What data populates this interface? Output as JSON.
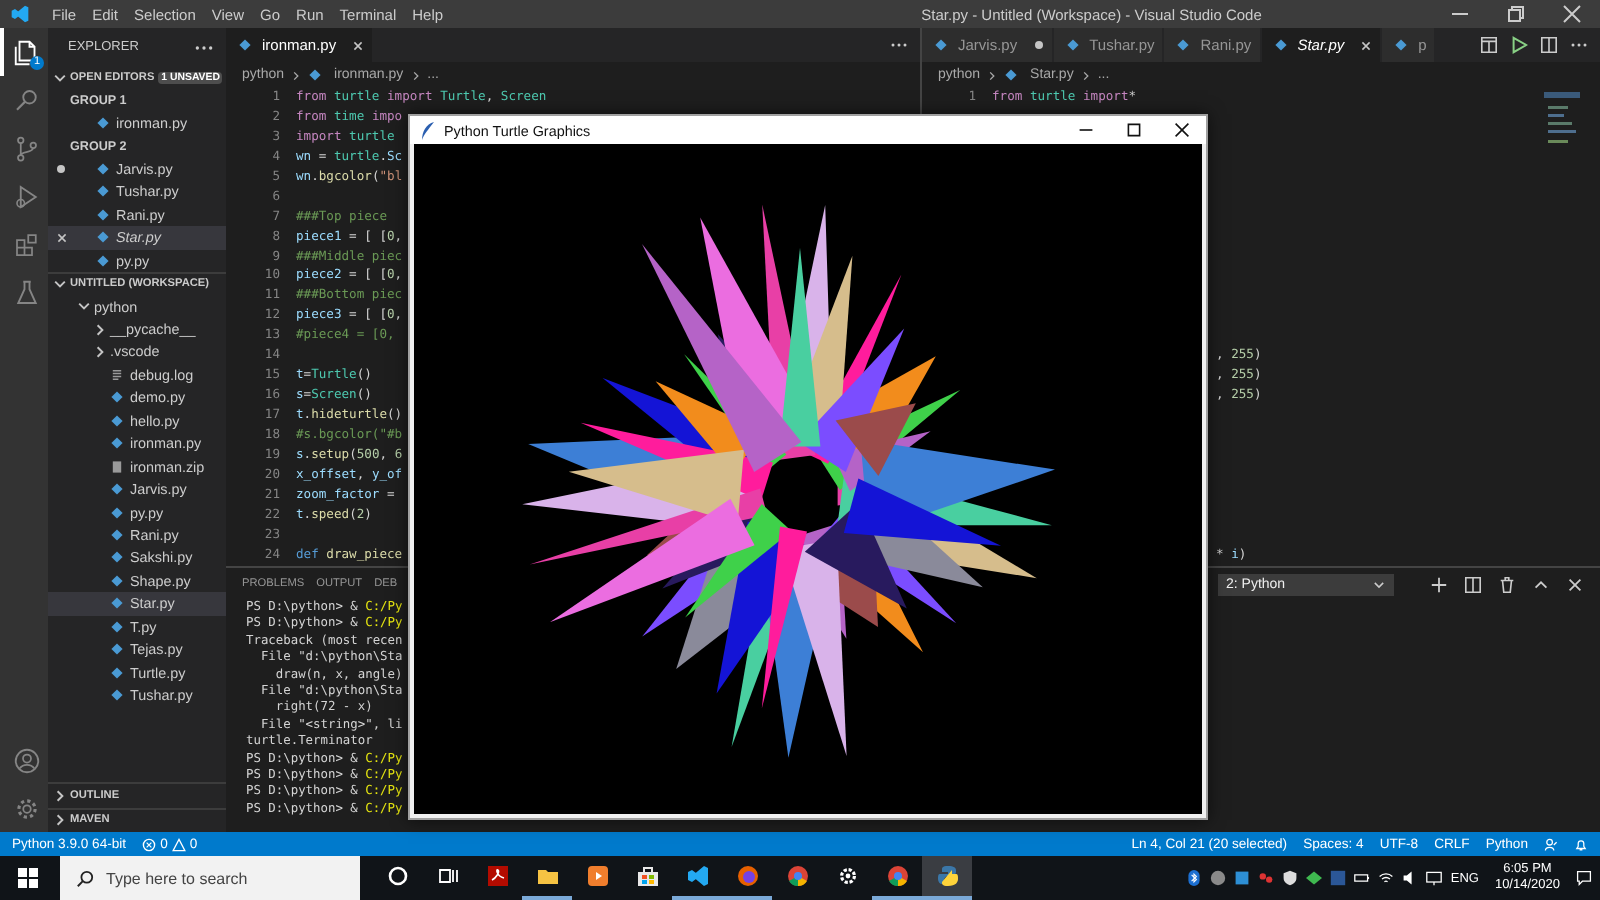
{
  "title_bar": {
    "menu": [
      "File",
      "Edit",
      "Selection",
      "View",
      "Go",
      "Run",
      "Terminal",
      "Help"
    ],
    "title": "Star.py - Untitled (Workspace) - Visual Studio Code"
  },
  "activity_bar": {
    "items": [
      {
        "kind": "explorer",
        "selected": true,
        "badge": "1"
      },
      {
        "kind": "search",
        "selected": false
      },
      {
        "kind": "source-control",
        "selected": false
      },
      {
        "kind": "run",
        "selected": false
      },
      {
        "kind": "extensions",
        "selected": false
      },
      {
        "kind": "testing",
        "selected": false
      }
    ]
  },
  "sidebar": {
    "title": "EXPLORER",
    "open_editors": {
      "title": "OPEN EDITORS",
      "badge": "1 UNSAVED",
      "expanded": true,
      "groups": [
        {
          "title": "GROUP 1",
          "files": [
            {
              "name": "ironman.py",
              "selected": false,
              "dirty": false,
              "preview": false
            }
          ]
        },
        {
          "title": "GROUP 2",
          "files": [
            {
              "name": "Jarvis.py",
              "selected": false,
              "dirty": true,
              "preview": false
            },
            {
              "name": "Tushar.py",
              "selected": false,
              "dirty": false,
              "preview": false
            },
            {
              "name": "Rani.py",
              "selected": false,
              "dirty": false,
              "preview": false
            },
            {
              "name": "Star.py",
              "selected": true,
              "dirty": false,
              "preview": true
            },
            {
              "name": "py.py",
              "selected": false,
              "dirty": false,
              "preview": false
            }
          ]
        }
      ]
    },
    "workspace": {
      "title": "UNTITLED (WORKSPACE)",
      "expanded": true,
      "children": [
        {
          "name": "python",
          "kind": "folder",
          "expanded": true,
          "children": [
            {
              "name": "__pycache__",
              "kind": "folder",
              "expanded": false
            },
            {
              "name": ".vscode",
              "kind": "folder",
              "expanded": false
            },
            {
              "name": "debug.log",
              "kind": "log",
              "selected": false
            },
            {
              "name": "demo.py",
              "kind": "python",
              "selected": false
            },
            {
              "name": "hello.py",
              "kind": "python",
              "selected": false
            },
            {
              "name": "ironman.py",
              "kind": "python",
              "selected": false
            },
            {
              "name": "ironman.zip",
              "kind": "zip",
              "selected": false
            },
            {
              "name": "Jarvis.py",
              "kind": "python",
              "selected": false
            },
            {
              "name": "py.py",
              "kind": "python",
              "selected": false
            },
            {
              "name": "Rani.py",
              "kind": "python",
              "selected": false
            },
            {
              "name": "Sakshi.py",
              "kind": "python",
              "selected": false
            },
            {
              "name": "Shape.py",
              "kind": "python",
              "selected": false
            },
            {
              "name": "Star.py",
              "kind": "python",
              "selected": true
            },
            {
              "name": "T.py",
              "kind": "python",
              "selected": false
            },
            {
              "name": "Tejas.py",
              "kind": "python",
              "selected": false
            },
            {
              "name": "Turtle.py",
              "kind": "python",
              "selected": false
            },
            {
              "name": "Tushar.py",
              "kind": "python",
              "selected": false
            }
          ]
        }
      ]
    },
    "sections": [
      {
        "title": "OUTLINE",
        "expanded": false
      },
      {
        "title": "MAVEN",
        "expanded": false
      }
    ]
  },
  "left_editor": {
    "tabs": [
      {
        "label": "ironman.py",
        "selected": true,
        "dirty": false,
        "preview": false
      }
    ],
    "breadcrumbs": [
      {
        "text": "python",
        "kind": "folder"
      },
      {
        "text": "ironman.py",
        "kind": "file"
      },
      {
        "text": "...",
        "kind": "symbol"
      }
    ],
    "lines": [
      {
        "number": "1",
        "tokens": [
          {
            "text": "from ",
            "kind": "kw"
          },
          {
            "text": "turtle ",
            "kind": "type"
          },
          {
            "text": "import ",
            "kind": "kw"
          },
          {
            "text": "Turtle",
            "kind": "type"
          },
          {
            "text": ", ",
            "kind": "plain"
          },
          {
            "text": "Screen",
            "kind": "type"
          }
        ]
      },
      {
        "number": "2",
        "tokens": [
          {
            "text": "from ",
            "kind": "kw"
          },
          {
            "text": "time ",
            "kind": "type"
          },
          {
            "text": "impo",
            "kind": "kw"
          }
        ]
      },
      {
        "number": "3",
        "tokens": [
          {
            "text": "import ",
            "kind": "kw"
          },
          {
            "text": "turtle",
            "kind": "type"
          }
        ]
      },
      {
        "number": "4",
        "tokens": [
          {
            "text": "wn",
            "kind": "var"
          },
          {
            "text": " = ",
            "kind": "plain"
          },
          {
            "text": "turtle",
            "kind": "type"
          },
          {
            "text": ".",
            "kind": "plain"
          },
          {
            "text": "Sc",
            "kind": "var"
          }
        ]
      },
      {
        "number": "5",
        "tokens": [
          {
            "text": "wn",
            "kind": "var"
          },
          {
            "text": ".",
            "kind": "plain"
          },
          {
            "text": "bgcolor",
            "kind": "fn"
          },
          {
            "text": "(",
            "kind": "plain"
          },
          {
            "text": "\"bl",
            "kind": "str"
          }
        ]
      },
      {
        "number": "6"
      },
      {
        "number": "7",
        "tokens": [
          {
            "text": "###Top piece",
            "kind": "comment"
          }
        ]
      },
      {
        "number": "8",
        "tokens": [
          {
            "text": "piece1",
            "kind": "var"
          },
          {
            "text": " = [ [",
            "kind": "plain"
          },
          {
            "text": "0",
            "kind": "num"
          },
          {
            "text": ",",
            "kind": "plain"
          }
        ]
      },
      {
        "number": "9",
        "tokens": [
          {
            "text": "###Middle piec",
            "kind": "comment"
          }
        ]
      },
      {
        "number": "10",
        "tokens": [
          {
            "text": "piece2",
            "kind": "var"
          },
          {
            "text": " = [ [",
            "kind": "plain"
          },
          {
            "text": "0",
            "kind": "num"
          },
          {
            "text": ",",
            "kind": "plain"
          }
        ]
      },
      {
        "number": "11",
        "tokens": [
          {
            "text": "###Bottom piec",
            "kind": "comment"
          }
        ]
      },
      {
        "number": "12",
        "tokens": [
          {
            "text": "piece3",
            "kind": "var"
          },
          {
            "text": " = [ [",
            "kind": "plain"
          },
          {
            "text": "0",
            "kind": "num"
          },
          {
            "text": ",",
            "kind": "plain"
          }
        ]
      },
      {
        "number": "13",
        "tokens": [
          {
            "text": "#piece4 = [0,",
            "kind": "comment"
          }
        ]
      },
      {
        "number": "14"
      },
      {
        "number": "15",
        "tokens": [
          {
            "text": "t",
            "kind": "var"
          },
          {
            "text": "=",
            "kind": "plain"
          },
          {
            "text": "Turtle",
            "kind": "type"
          },
          {
            "text": "()",
            "kind": "plain"
          }
        ]
      },
      {
        "number": "16",
        "tokens": [
          {
            "text": "s",
            "kind": "var"
          },
          {
            "text": "=",
            "kind": "plain"
          },
          {
            "text": "Screen",
            "kind": "type"
          },
          {
            "text": "()",
            "kind": "plain"
          }
        ]
      },
      {
        "number": "17",
        "tokens": [
          {
            "text": "t",
            "kind": "var"
          },
          {
            "text": ".",
            "kind": "plain"
          },
          {
            "text": "hideturtle",
            "kind": "fn"
          },
          {
            "text": "()",
            "kind": "plain"
          }
        ]
      },
      {
        "number": "18",
        "tokens": [
          {
            "text": "#s.bgcolor(\"#b",
            "kind": "comment"
          }
        ]
      },
      {
        "number": "19",
        "tokens": [
          {
            "text": "s",
            "kind": "var"
          },
          {
            "text": ".",
            "kind": "plain"
          },
          {
            "text": "setup",
            "kind": "fn"
          },
          {
            "text": "(",
            "kind": "plain"
          },
          {
            "text": "500",
            "kind": "num"
          },
          {
            "text": ", ",
            "kind": "plain"
          },
          {
            "text": "6",
            "kind": "num"
          }
        ]
      },
      {
        "number": "20",
        "tokens": [
          {
            "text": "x_offset",
            "kind": "var"
          },
          {
            "text": ", ",
            "kind": "plain"
          },
          {
            "text": "y_of",
            "kind": "var"
          }
        ]
      },
      {
        "number": "21",
        "tokens": [
          {
            "text": "zoom_factor",
            "kind": "var"
          },
          {
            "text": " =",
            "kind": "plain"
          }
        ]
      },
      {
        "number": "22",
        "tokens": [
          {
            "text": "t",
            "kind": "var"
          },
          {
            "text": ".",
            "kind": "plain"
          },
          {
            "text": "speed",
            "kind": "fn"
          },
          {
            "text": "(",
            "kind": "plain"
          },
          {
            "text": "2",
            "kind": "num"
          },
          {
            "text": ")",
            "kind": "plain"
          }
        ]
      },
      {
        "number": "23"
      },
      {
        "number": "24",
        "tokens": [
          {
            "text": "def ",
            "kind": "def"
          },
          {
            "text": "draw_piece",
            "kind": "fn"
          }
        ]
      }
    ]
  },
  "right_editor": {
    "tabs": [
      {
        "label": "Jarvis.py",
        "selected": false,
        "dirty": true,
        "preview": false
      },
      {
        "label": "Tushar.py",
        "selected": false,
        "dirty": false,
        "preview": false
      },
      {
        "label": "Rani.py",
        "selected": false,
        "dirty": false,
        "preview": false
      },
      {
        "label": "Star.py",
        "selected": true,
        "dirty": false,
        "preview": true
      },
      {
        "label": "p",
        "selected": false,
        "dirty": false,
        "preview": false
      }
    ],
    "breadcrumbs": [
      {
        "text": "python",
        "kind": "folder"
      },
      {
        "text": "Star.py",
        "kind": "file"
      },
      {
        "text": "...",
        "kind": "symbol"
      }
    ],
    "lines": [
      {
        "number": "1",
        "tokens": [
          {
            "text": "from ",
            "kind": "kw"
          },
          {
            "text": "turtle ",
            "kind": "type"
          },
          {
            "text": "import",
            "kind": "kw"
          },
          {
            "text": "*",
            "kind": "plain"
          }
        ]
      }
    ],
    "fragments": [
      {
        "tokens": [
          {
            "text": ", ",
            "kind": "plain"
          },
          {
            "text": "255",
            "kind": "num"
          },
          {
            "text": ")",
            "kind": "plain"
          }
        ]
      },
      {
        "tokens": [
          {
            "text": ", ",
            "kind": "plain"
          },
          {
            "text": "255",
            "kind": "num"
          },
          {
            "text": ")",
            "kind": "plain"
          }
        ]
      },
      {
        "tokens": [
          {
            "text": ", ",
            "kind": "plain"
          },
          {
            "text": "255",
            "kind": "num"
          },
          {
            "text": ")",
            "kind": "plain"
          }
        ]
      },
      {
        "tokens": [
          {
            "text": "* ",
            "kind": "plain"
          },
          {
            "text": "i",
            "kind": "var"
          },
          {
            "text": ")",
            "kind": "plain"
          }
        ]
      }
    ]
  },
  "panel": {
    "tabs": [
      {
        "label": "PROBLEMS",
        "selected": false
      },
      {
        "label": "OUTPUT",
        "selected": false
      },
      {
        "label": "DEB",
        "selected": false
      }
    ],
    "terminal_select": "2: Python",
    "terminal_lines": [
      [
        {
          "text": "PS D:\\python> & ",
          "kind": "plain"
        },
        {
          "text": "C:/Py",
          "kind": "path"
        }
      ],
      [
        {
          "text": "PS D:\\python> & ",
          "kind": "plain"
        },
        {
          "text": "C:/Py",
          "kind": "path"
        }
      ],
      [
        {
          "text": "Traceback (most recen",
          "kind": "plain"
        }
      ],
      [
        {
          "text": "  File \"d:\\python\\Sta",
          "kind": "plain"
        }
      ],
      [
        {
          "text": "    draw(n, x, angle)",
          "kind": "plain"
        }
      ],
      [
        {
          "text": "  File \"d:\\python\\Sta",
          "kind": "plain"
        }
      ],
      [
        {
          "text": "    right(72 - x)",
          "kind": "plain"
        }
      ],
      [
        {
          "text": "  File \"<string>\", li",
          "kind": "plain"
        }
      ],
      [
        {
          "text": "turtle.Terminator",
          "kind": "plain"
        }
      ],
      [
        {
          "text": "PS D:\\python> & ",
          "kind": "plain"
        },
        {
          "text": "C:/Py",
          "kind": "path"
        }
      ],
      [
        {
          "text": "PS D:\\python> & ",
          "kind": "plain"
        },
        {
          "text": "C:/Py",
          "kind": "path"
        }
      ],
      [
        {
          "text": "PS D:\\python> & ",
          "kind": "plain"
        },
        {
          "text": "C:/Py",
          "kind": "path"
        }
      ],
      [
        {
          "text": "PS D:\\python> & ",
          "kind": "plain"
        },
        {
          "text": "C:/Py",
          "kind": "path"
        }
      ]
    ]
  },
  "turtle_window": {
    "title": "Python Turtle Graphics"
  },
  "status_bar": {
    "interpreter": "Python 3.9.0 64-bit",
    "errors": "0",
    "warnings": "0",
    "right": [
      "Ln 4, Col 21 (20 selected)",
      "Spaces: 4",
      "UTF-8",
      "CRLF",
      "Python"
    ]
  },
  "taskbar": {
    "search": {
      "placeholder": "Type here to search"
    },
    "apps": [
      {
        "kind": "pdf",
        "running": false,
        "selected": false
      },
      {
        "kind": "folder",
        "running": true,
        "selected": false
      },
      {
        "kind": "media",
        "running": false,
        "selected": false
      },
      {
        "kind": "store",
        "running": false,
        "selected": false
      },
      {
        "kind": "code",
        "running": true,
        "selected": false
      },
      {
        "kind": "firefox",
        "running": true,
        "selected": false
      },
      {
        "kind": "chrome",
        "running": false,
        "selected": false
      },
      {
        "kind": "settings",
        "running": false,
        "selected": false
      },
      {
        "kind": "chrome",
        "running": true,
        "selected": false
      },
      {
        "kind": "python",
        "running": true,
        "selected": true
      }
    ],
    "language": "ENG",
    "time": "6:05 PM",
    "date": "10/14/2020"
  }
}
